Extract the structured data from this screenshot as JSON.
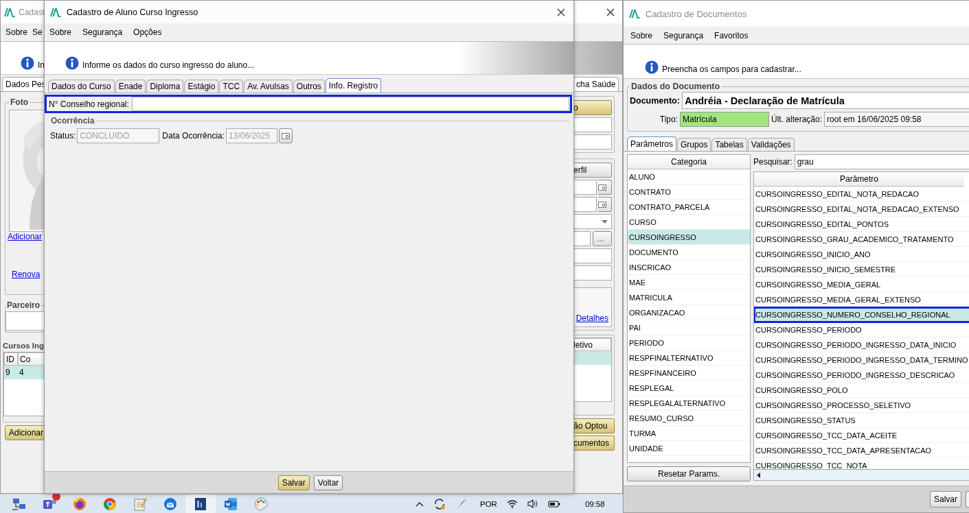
{
  "background_window": {
    "title": "Cadast",
    "menu": [
      "Sobre",
      "Se"
    ],
    "info_text": "In",
    "left": {
      "tab": "Dados Pes",
      "photo_group": "Foto",
      "links": [
        "Adicionar",
        "Renova"
      ],
      "partner_group": "Parceiro",
      "courses_group": "Cursos Ing",
      "table": {
        "columns": [
          "ID",
          "Co"
        ],
        "rows": [
          {
            "cells": [
              "9",
              "4"
            ],
            "selected": true
          }
        ]
      },
      "button": {
        "label": "Adicionar",
        "default": true
      }
    },
    "right": {
      "tab": "cha Saúde",
      "top_button": {
        "label": "o",
        "default": true
      },
      "profile_button": {
        "label": "erfil",
        "default": false
      },
      "browse_button": "...",
      "link": "Detalhes",
      "table_column": "letivo",
      "table_row_selected": true,
      "bottom_buttons": [
        {
          "label": "ão Optou",
          "default": true
        },
        {
          "label": "cumentos",
          "default": true
        }
      ]
    }
  },
  "dialog": {
    "title": "Cadastro de Aluno Curso Ingresso",
    "menu": [
      "Sobre",
      "Segurança",
      "Opções"
    ],
    "info_text": "Informe os dados do curso ingresso do aluno...",
    "tabs": [
      {
        "label": "Dados do Curso",
        "selected": false
      },
      {
        "label": "Enade",
        "selected": false
      },
      {
        "label": "Diploma",
        "selected": false
      },
      {
        "label": "Estágio",
        "selected": false
      },
      {
        "label": "TCC",
        "selected": false
      },
      {
        "label": "Av. Avulsas",
        "selected": false
      },
      {
        "label": "Outros",
        "selected": false
      },
      {
        "label": "Info. Registro",
        "selected": true
      }
    ],
    "register_field": {
      "label": "N° Conselho regional:",
      "highlighted": true
    },
    "occurrence": {
      "title": "Ocorrência",
      "status": {
        "label": "Status:",
        "value": "CONCLUIDO",
        "disabled": true
      },
      "date": {
        "label": "Data Ocorrência:",
        "value": "13/06/2025",
        "disabled": true
      }
    },
    "buttons": [
      {
        "label": "Salvar",
        "default": true
      },
      {
        "label": "Voltar",
        "default": false
      }
    ]
  },
  "documents_window": {
    "title": "Cadastro de Documentos",
    "menu": [
      "Sobre",
      "Segurança",
      "Favoritos"
    ],
    "info_text": "Preencha os campos para cadastrar...",
    "group": "Dados do Documento",
    "document": {
      "label": "Documento:",
      "value": "Andréia - Declaração de Matrícula"
    },
    "type": {
      "label": "Tipo:",
      "value": "Matrícula"
    },
    "last_change": {
      "label": "Últ. alteração:",
      "value": "root em 16/06/2025 09:58"
    },
    "tabs": [
      {
        "label": "Parâmetros",
        "selected": true
      },
      {
        "label": "Grupos",
        "selected": false
      },
      {
        "label": "Tabelas",
        "selected": false
      },
      {
        "label": "Validações",
        "selected": false
      }
    ],
    "categories": {
      "header": "Categoria",
      "items": [
        {
          "label": "ALUNO",
          "selected": false
        },
        {
          "label": "CONTRATO",
          "selected": false
        },
        {
          "label": "CONTRATO_PARCELA",
          "selected": false
        },
        {
          "label": "CURSO",
          "selected": false
        },
        {
          "label": "CURSOINGRESSO",
          "selected": true
        },
        {
          "label": "DOCUMENTO",
          "selected": false
        },
        {
          "label": "INSCRICAO",
          "selected": false
        },
        {
          "label": "MAE",
          "selected": false
        },
        {
          "label": "MATRICULA",
          "selected": false
        },
        {
          "label": "ORGANIZACAO",
          "selected": false
        },
        {
          "label": "PAI",
          "selected": false
        },
        {
          "label": "PERIODO",
          "selected": false
        },
        {
          "label": "RESPFINALTERNATIVO",
          "selected": false
        },
        {
          "label": "RESPFINANCEIRO",
          "selected": false
        },
        {
          "label": "RESPLEGAL",
          "selected": false
        },
        {
          "label": "RESPLEGALALTERNATIVO",
          "selected": false
        },
        {
          "label": "RESUMO_CURSO",
          "selected": false
        },
        {
          "label": "TURMA",
          "selected": false
        },
        {
          "label": "UNIDADE",
          "selected": false
        }
      ]
    },
    "reset_button": "Resetar Params.",
    "search": {
      "label": "Pesquisar:",
      "value": "grau"
    },
    "parameters": {
      "header": "Parâmetro",
      "rows": [
        {
          "label": "CURSOINGRESSO_EDITAL_NOTA_REDACAO",
          "selected": false,
          "highlighted": false
        },
        {
          "label": "CURSOINGRESSO_EDITAL_NOTA_REDACAO_EXTENSO",
          "selected": false,
          "highlighted": false
        },
        {
          "label": "CURSOINGRESSO_EDITAL_PONTOS",
          "selected": false,
          "highlighted": false
        },
        {
          "label": "CURSOINGRESSO_GRAU_ACADEMICO_TRATAMENTO",
          "selected": false,
          "highlighted": false
        },
        {
          "label": "CURSOINGRESSO_INICIO_ANO",
          "selected": false,
          "highlighted": false
        },
        {
          "label": "CURSOINGRESSO_INICIO_SEMESTRE",
          "selected": false,
          "highlighted": false
        },
        {
          "label": "CURSOINGRESSO_MEDIA_GERAL",
          "selected": false,
          "highlighted": false
        },
        {
          "label": "CURSOINGRESSO_MEDIA_GERAL_EXTENSO",
          "selected": false,
          "highlighted": false
        },
        {
          "label": "CURSOINGRESSO_NUMERO_CONSELHO_REGIONAL",
          "selected": true,
          "highlighted": true
        },
        {
          "label": "CURSOINGRESSO_PERIODO",
          "selected": false,
          "highlighted": false
        },
        {
          "label": "CURSOINGRESSO_PERIODO_INGRESSO_DATA_INICIO",
          "selected": false,
          "highlighted": false
        },
        {
          "label": "CURSOINGRESSO_PERIODO_INGRESSO_DATA_TERMINO",
          "selected": false,
          "highlighted": false
        },
        {
          "label": "CURSOINGRESSO_PERIODO_INGRESSO_DESCRICAO",
          "selected": false,
          "highlighted": false
        },
        {
          "label": "CURSOINGRESSO_POLO",
          "selected": false,
          "highlighted": false
        },
        {
          "label": "CURSOINGRESSO_PROCESSO_SELETIVO",
          "selected": false,
          "highlighted": false
        },
        {
          "label": "CURSOINGRESSO_STATUS",
          "selected": false,
          "highlighted": false
        },
        {
          "label": "CURSOINGRESSO_TCC_DATA_ACEITE",
          "selected": false,
          "highlighted": false
        },
        {
          "label": "CURSOINGRESSO_TCC_DATA_APRESENTACAO",
          "selected": false,
          "highlighted": false
        },
        {
          "label": "CURSOINGRESSO_TCC_NOTA",
          "selected": false,
          "highlighted": false
        }
      ]
    },
    "buttons": [
      "Salvar"
    ]
  },
  "taskbar": {
    "apps": [
      {
        "kind": "network",
        "selected": false,
        "badge": false
      },
      {
        "kind": "teams",
        "selected": false,
        "badge": true
      },
      {
        "kind": "firefox",
        "selected": false,
        "badge": false
      },
      {
        "kind": "chrome",
        "selected": false,
        "badge": false
      },
      {
        "kind": "notepad",
        "selected": false,
        "badge": false
      },
      {
        "kind": "thunderbird",
        "selected": false,
        "badge": false
      },
      {
        "kind": "di",
        "selected": true,
        "badge": false
      },
      {
        "kind": "word",
        "selected": false,
        "badge": false
      },
      {
        "kind": "paint",
        "selected": false,
        "badge": false
      }
    ],
    "language": "POR",
    "time": "09:58"
  }
}
